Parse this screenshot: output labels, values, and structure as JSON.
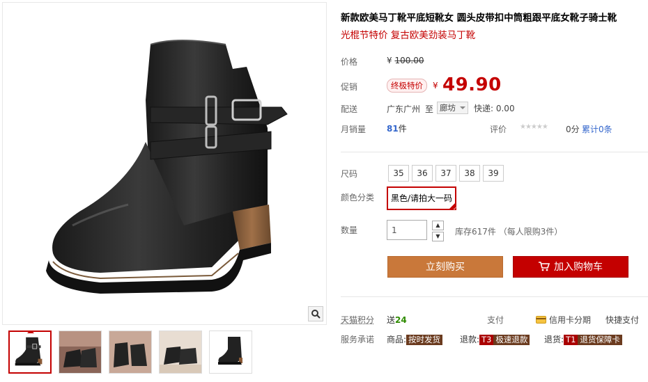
{
  "product": {
    "title": "新款欧美马丁靴平底短靴女 圆头皮带扣中筒粗跟平底女靴子骑士靴",
    "subtitle": "光棍节特价 复古欧美劲装马丁靴"
  },
  "price": {
    "label": "价格",
    "currency": "¥",
    "original": "100.00"
  },
  "promo": {
    "label": "促销",
    "badge": "终极特价",
    "currency": "¥",
    "price": "49.90"
  },
  "shipping": {
    "label": "配送",
    "from": "广东广州",
    "to_word": "至",
    "destination": "廊坊",
    "fee": "快递: 0.00"
  },
  "sales": {
    "label": "月销量",
    "count": "81",
    "unit": "件",
    "review_label": "评价",
    "stars": "★★★★★",
    "score": "0分",
    "review_total": "累计0条"
  },
  "size": {
    "label": "尺码",
    "options": [
      "35",
      "36",
      "37",
      "38",
      "39"
    ]
  },
  "color": {
    "label": "颜色分类",
    "selected": "黑色/请拍大一码"
  },
  "quantity": {
    "label": "数量",
    "value": "1",
    "stock": "库存617件",
    "limit": "（每人限购3件）"
  },
  "actions": {
    "buy_now": "立刻购买",
    "add_cart": "加入购物车"
  },
  "points": {
    "label": "天猫积分",
    "send_word": "送",
    "amount": "24",
    "pay_label": "支付",
    "credit": "信用卡分期",
    "quick": "快捷支付"
  },
  "service": {
    "label": "服务承诺",
    "goods_label": "商品:",
    "goods_tag": "按时发货",
    "return_label": "退款:",
    "return_code": "T3",
    "return_tag": "极速退款",
    "refund_label": "退货:",
    "refund_code": "T1",
    "refund_tag": "退货保障卡"
  },
  "colors": {
    "accent": "#c40000",
    "buy_button": "#c9783a",
    "sales_count": "#3366cc",
    "points_amount": "#2e8b00"
  },
  "gallery": {
    "thumb_count": 5
  }
}
